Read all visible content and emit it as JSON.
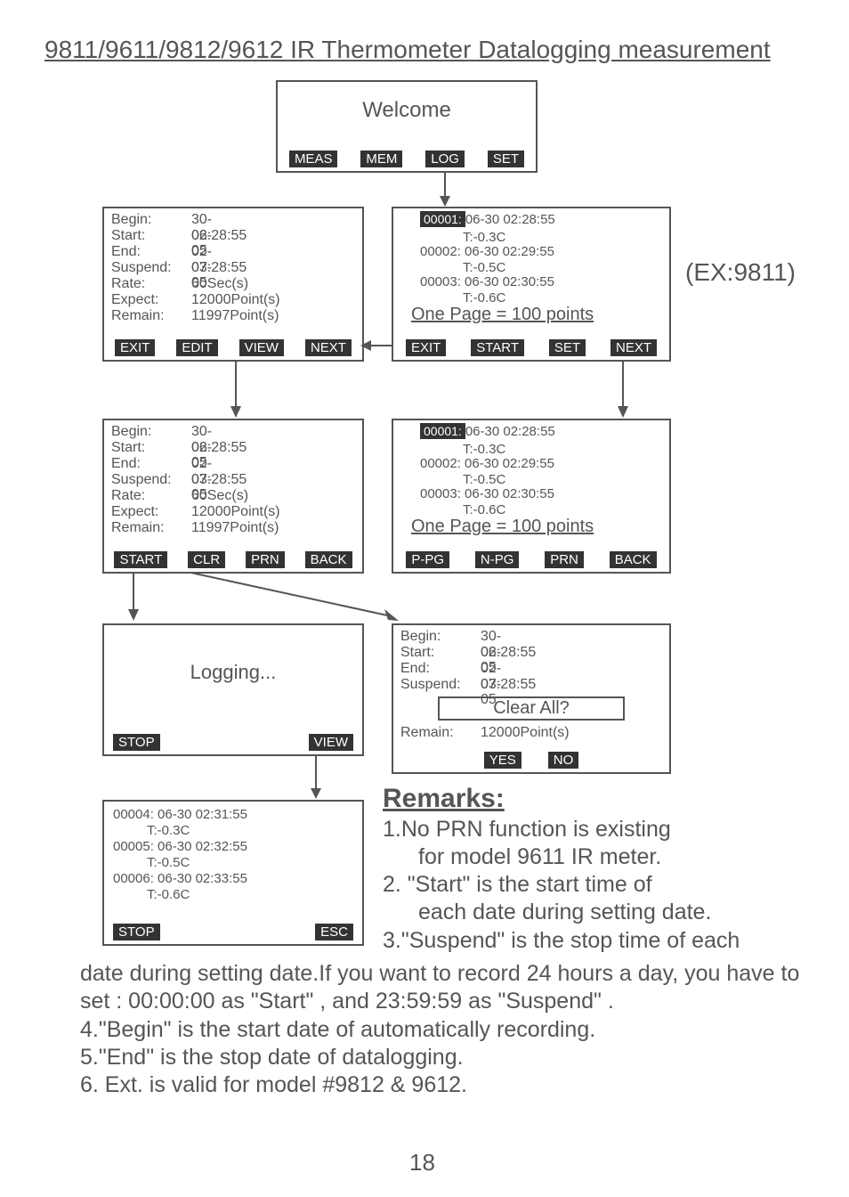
{
  "title": "9811/9611/9812/9612 IR Thermometer Datalogging measurement",
  "pageNum": "18",
  "exLabel": "(EX:9811)",
  "welcome": {
    "text": "Welcome",
    "btns": [
      "MEAS",
      "MEM",
      "LOG",
      "SET"
    ]
  },
  "editScreen": {
    "lines": {
      "begin_l": "Begin:",
      "begin_v": "30-06-05",
      "start_l": "Start:",
      "start_v": "02:28:55",
      "end_l": "End:",
      "end_v": "02-07-05",
      "susp_l": "Suspend:",
      "susp_v": "03:28:55",
      "rate_l": "Rate:",
      "rate_v": "60Sec(s)",
      "exp_l": "Expect:",
      "exp_v": "12000Point(s)",
      "rem_l": "Remain:",
      "rem_v": "11997Point(s)"
    },
    "btns": [
      "EXIT",
      "EDIT",
      "VIEW",
      "NEXT"
    ]
  },
  "logScreen1": {
    "l1a": "00001:",
    "l1b": "06-30 02:28:55",
    "l2": "T:-0.3C",
    "l3": "00002: 06-30 02:29:55",
    "l4": "T:-0.5C",
    "l5": "00003: 06-30 02:30:55",
    "l6": "T:-0.6C",
    "l7": "One Page = 100 points",
    "btns": [
      "EXIT",
      "START",
      "SET",
      "NEXT"
    ]
  },
  "startScreen": {
    "lines": {
      "begin_l": "Begin:",
      "begin_v": "30-06-05",
      "start_l": "Start:",
      "start_v": "02:28:55",
      "end_l": "End:",
      "end_v": "02-07-05",
      "susp_l": "Suspend:",
      "susp_v": "03:28:55",
      "rate_l": "Rate:",
      "rate_v": "60Sec(s)",
      "exp_l": "Expect:",
      "exp_v": "12000Point(s)",
      "rem_l": "Remain:",
      "rem_v": "11997Point(s)"
    },
    "btns": [
      "START",
      "CLR",
      "PRN",
      "BACK"
    ]
  },
  "logScreen2": {
    "l1a": "00001:",
    "l1b": "06-30 02:28:55",
    "l2": "T:-0.3C",
    "l3": "00002: 06-30 02:29:55",
    "l4": "T:-0.5C",
    "l5": "00003: 06-30 02:30:55",
    "l6": "T:-0.6C",
    "l7": "One Page = 100 points",
    "btns": [
      "P-PG",
      "N-PG",
      "PRN",
      "BACK"
    ]
  },
  "loggingScreen": {
    "text": "Logging...",
    "btns": [
      "STOP",
      "VIEW"
    ]
  },
  "clearScreen": {
    "begin_l": "Begin:",
    "begin_v": "30-06-05",
    "start_l": "Start:",
    "start_v": "02:28:55",
    "end_l": "End:",
    "end_v": "02-07-05",
    "susp_l": "Suspend:",
    "susp_v": "03:28:55",
    "clearText": "Clear All?",
    "rem_l": "Remain:",
    "rem_v": "12000Point(s)",
    "btns": [
      "YES",
      "NO"
    ]
  },
  "viewScreen": {
    "l1": "00004: 06-30 02:31:55",
    "l2": "T:-0.3C",
    "l3": "00005: 06-30 02:32:55",
    "l4": "T:-0.5C",
    "l5": "00006: 06-30 02:33:55",
    "l6": "T:-0.6C",
    "btns": [
      "STOP",
      "ESC"
    ]
  },
  "remarks": {
    "heading": "Remarks:",
    "r1": "1.No PRN function is existing",
    "r1b": "for model 9611 IR meter.",
    "r2": "2. \"Start\" is the start time of",
    "r2b": "each date during setting date.",
    "r3": "3.\"Suspend\" is the stop time of each",
    "b1": "date during setting date.If you want to record 24 hours a day, you have to set : 00:00:00 as \"Start\" , and 23:59:59  as \"Suspend\" .",
    "b2": "4.\"Begin\" is the start date of automatically recording.",
    "b3": "5.\"End\" is the stop date of datalogging.",
    "b4": "6. Ext. is valid for model #9812 & 9612."
  }
}
